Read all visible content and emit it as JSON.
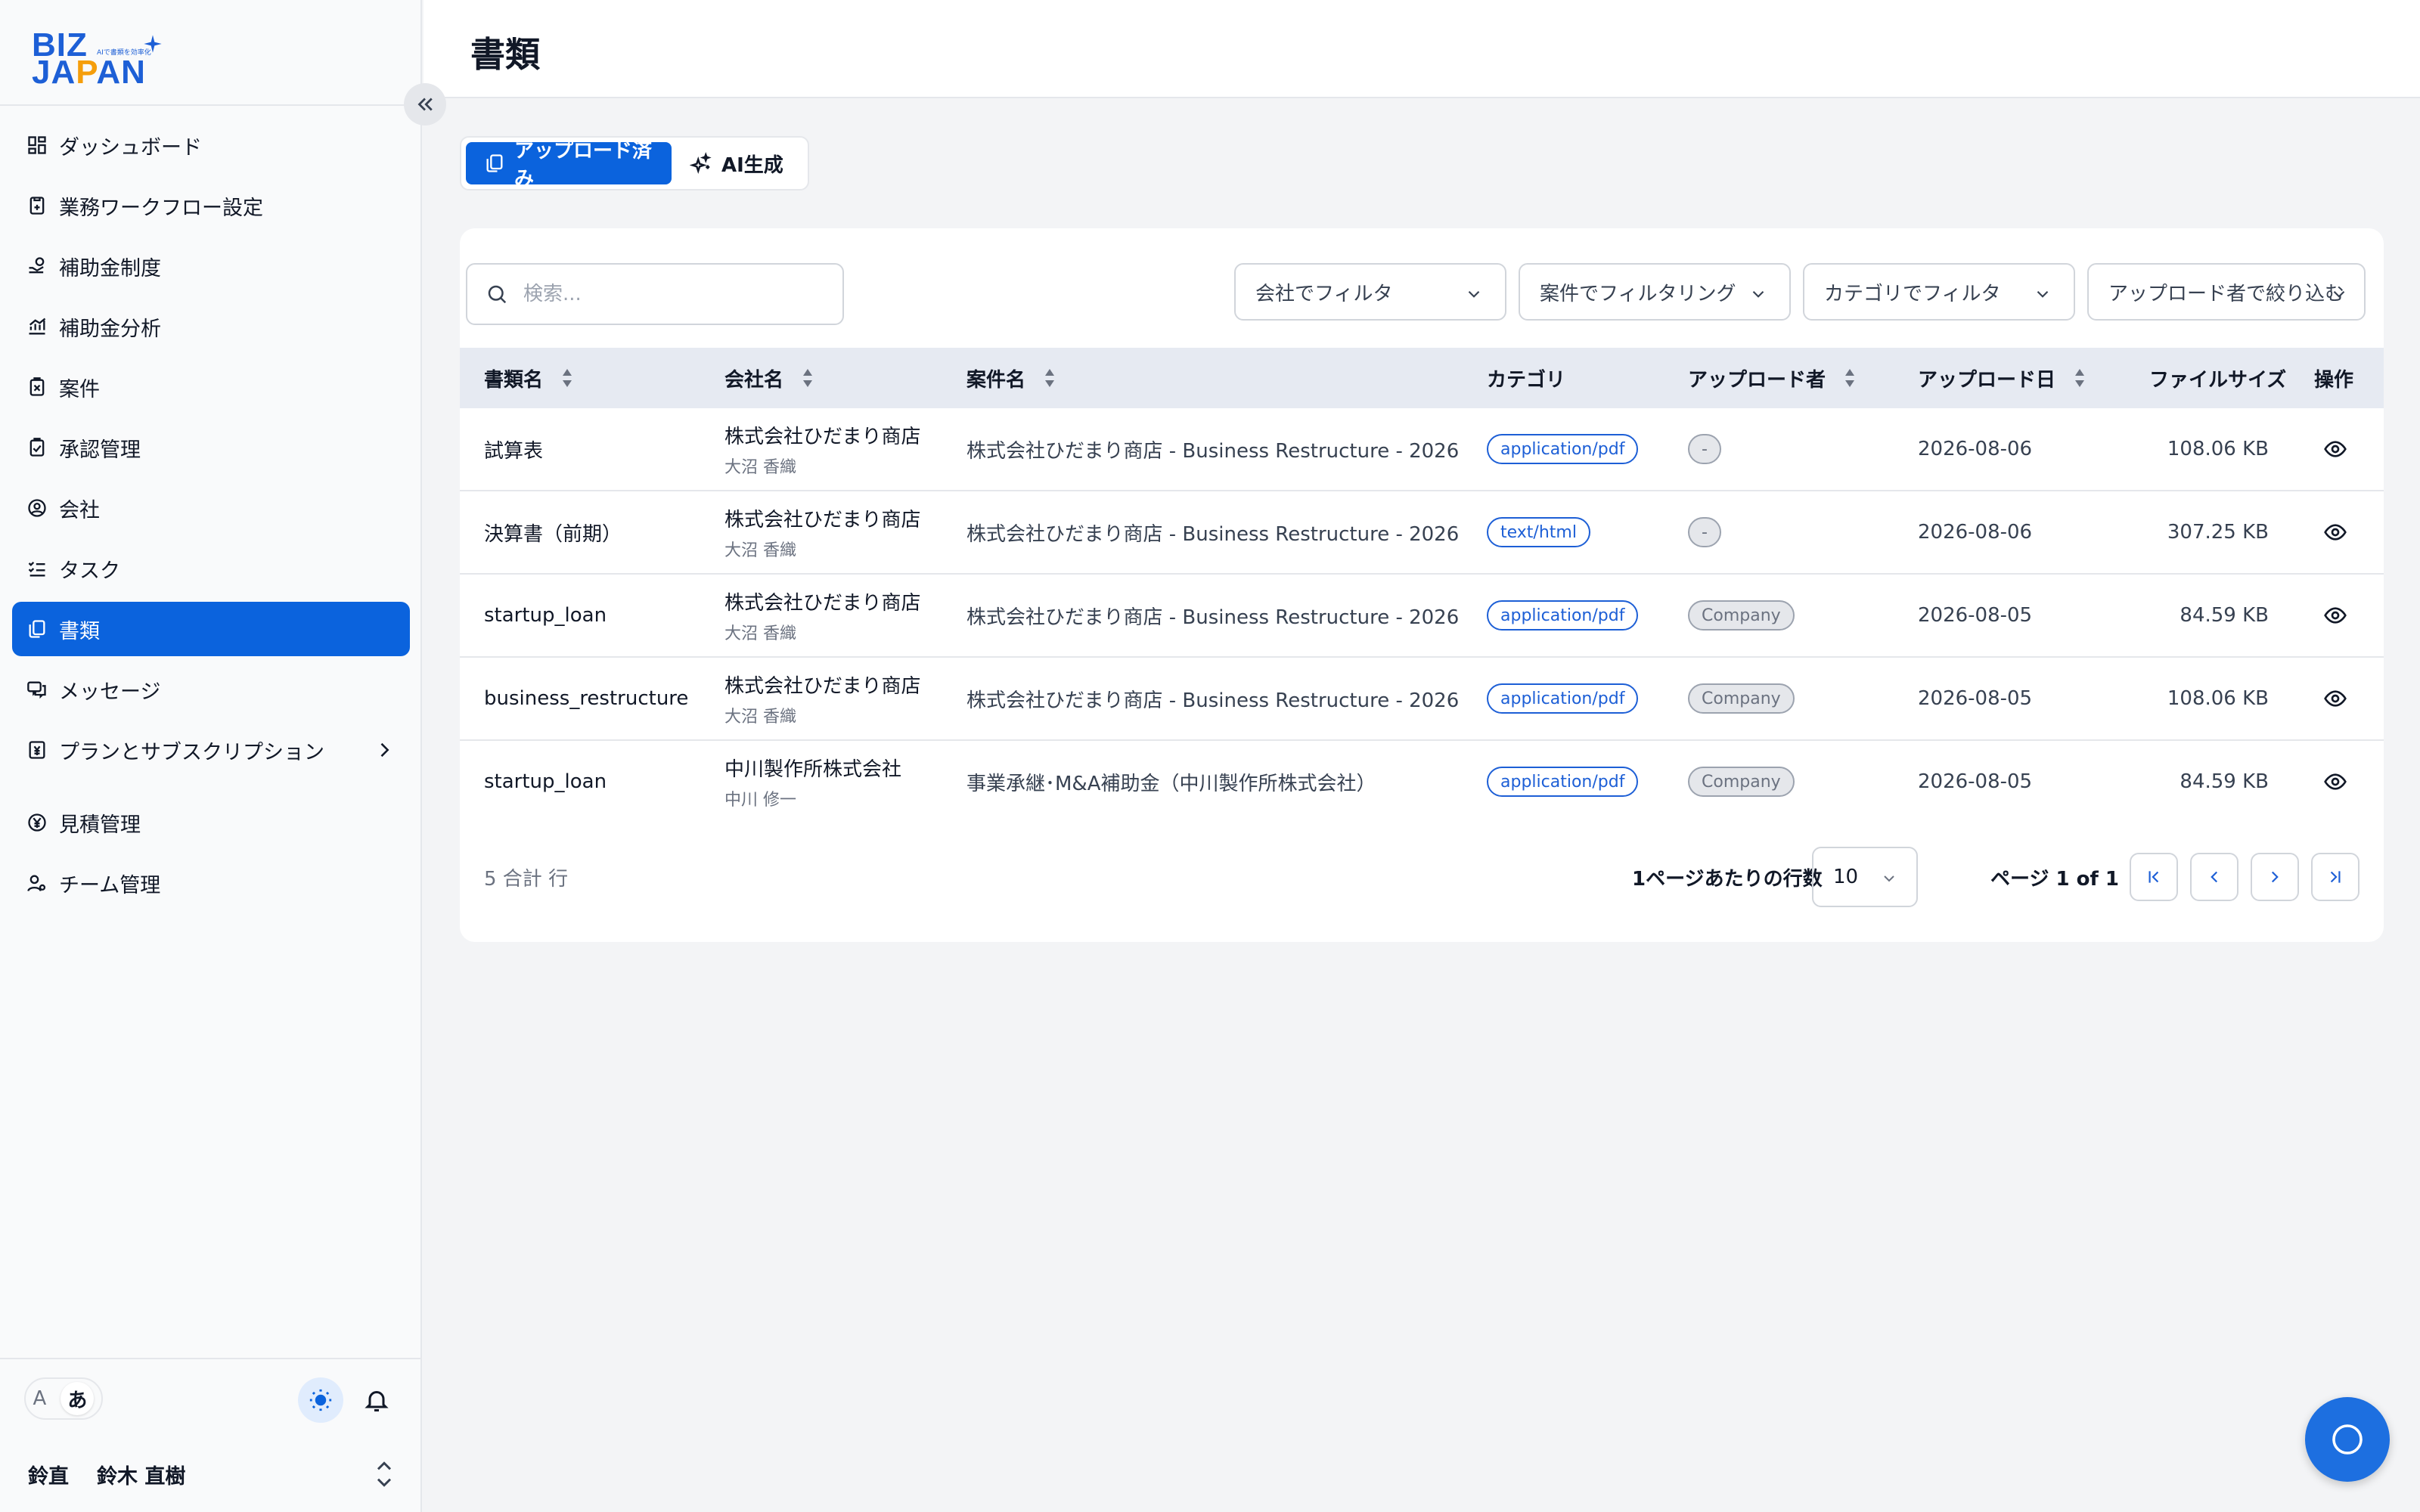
{
  "app": {
    "logo_line1": "BIZ",
    "logo_line2a": "JA",
    "logo_line2b": "P",
    "logo_line2c": "AN",
    "logo_tagline": "AIで書類を効率化",
    "brand_color": "#1d5fd6",
    "accent_color": "#0b63dd"
  },
  "sidebar": {
    "items": [
      {
        "label": "ダッシュボード",
        "icon": "dashboard-icon"
      },
      {
        "label": "業務ワークフロー設定",
        "icon": "workflow-icon"
      },
      {
        "label": "補助金制度",
        "icon": "subsidy-icon"
      },
      {
        "label": "補助金分析",
        "icon": "analytics-icon"
      },
      {
        "label": "案件",
        "icon": "clipboard-icon"
      },
      {
        "label": "承認管理",
        "icon": "approval-icon"
      },
      {
        "label": "会社",
        "icon": "company-icon"
      },
      {
        "label": "タスク",
        "icon": "tasks-icon"
      },
      {
        "label": "書類",
        "icon": "documents-icon",
        "active": true
      },
      {
        "label": "メッセージ",
        "icon": "message-icon"
      },
      {
        "label": "プランとサブスクリプション",
        "icon": "plan-icon"
      },
      {
        "label": "見積管理",
        "icon": "yen-icon"
      },
      {
        "label": "チーム管理",
        "icon": "team-icon"
      }
    ],
    "lang_en": "A",
    "lang_ja": "あ",
    "user_initials": "鈴直",
    "user_name": "鈴木 直樹"
  },
  "header": {
    "title": "書類"
  },
  "tabs": [
    {
      "label": "アップロード済み",
      "active": true
    },
    {
      "label": "AI生成",
      "active": false
    }
  ],
  "toolbar": {
    "search_placeholder": "検索...",
    "filter_company": "会社でフィルタ",
    "filter_project": "案件でフィルタリング",
    "filter_category": "カテゴリでフィルタ",
    "filter_uploader": "アップロード者で絞り込む"
  },
  "table": {
    "columns": [
      "書類名",
      "会社名",
      "案件名",
      "カテゴリ",
      "アップロード者",
      "アップロード日",
      "ファイルサイズ",
      "操作"
    ],
    "rows": [
      {
        "doc": "試算表",
        "company": "株式会社ひだまり商店",
        "contact": "大沼 香織",
        "project": "株式会社ひだまり商店 - Business Restructure - 2026",
        "category": "application/pdf",
        "uploader": "-",
        "date": "2026-08-06",
        "size": "108.06 KB"
      },
      {
        "doc": "決算書（前期）",
        "company": "株式会社ひだまり商店",
        "contact": "大沼 香織",
        "project": "株式会社ひだまり商店 - Business Restructure - 2026",
        "category": "text/html",
        "uploader": "-",
        "date": "2026-08-06",
        "size": "307.25 KB"
      },
      {
        "doc": "startup_loan",
        "company": "株式会社ひだまり商店",
        "contact": "大沼 香織",
        "project": "株式会社ひだまり商店 - Business Restructure - 2026",
        "category": "application/pdf",
        "uploader": "Company",
        "date": "2026-08-05",
        "size": "84.59 KB"
      },
      {
        "doc": "business_restructure",
        "company": "株式会社ひだまり商店",
        "contact": "大沼 香織",
        "project": "株式会社ひだまり商店 - Business Restructure - 2026",
        "category": "application/pdf",
        "uploader": "Company",
        "date": "2026-08-05",
        "size": "108.06 KB"
      },
      {
        "doc": "startup_loan",
        "company": "中川製作所株式会社",
        "contact": "中川 修一",
        "project": "事業承継･M&A補助金（中川製作所株式会社）",
        "category": "application/pdf",
        "uploader": "Company",
        "date": "2026-08-05",
        "size": "84.59 KB"
      }
    ]
  },
  "pagination": {
    "total_text": "5 合計 行",
    "rows_per_page_label": "1ページあたりの行数",
    "rows_per_page_value": "10",
    "page_info": "ページ 1 of 1"
  }
}
